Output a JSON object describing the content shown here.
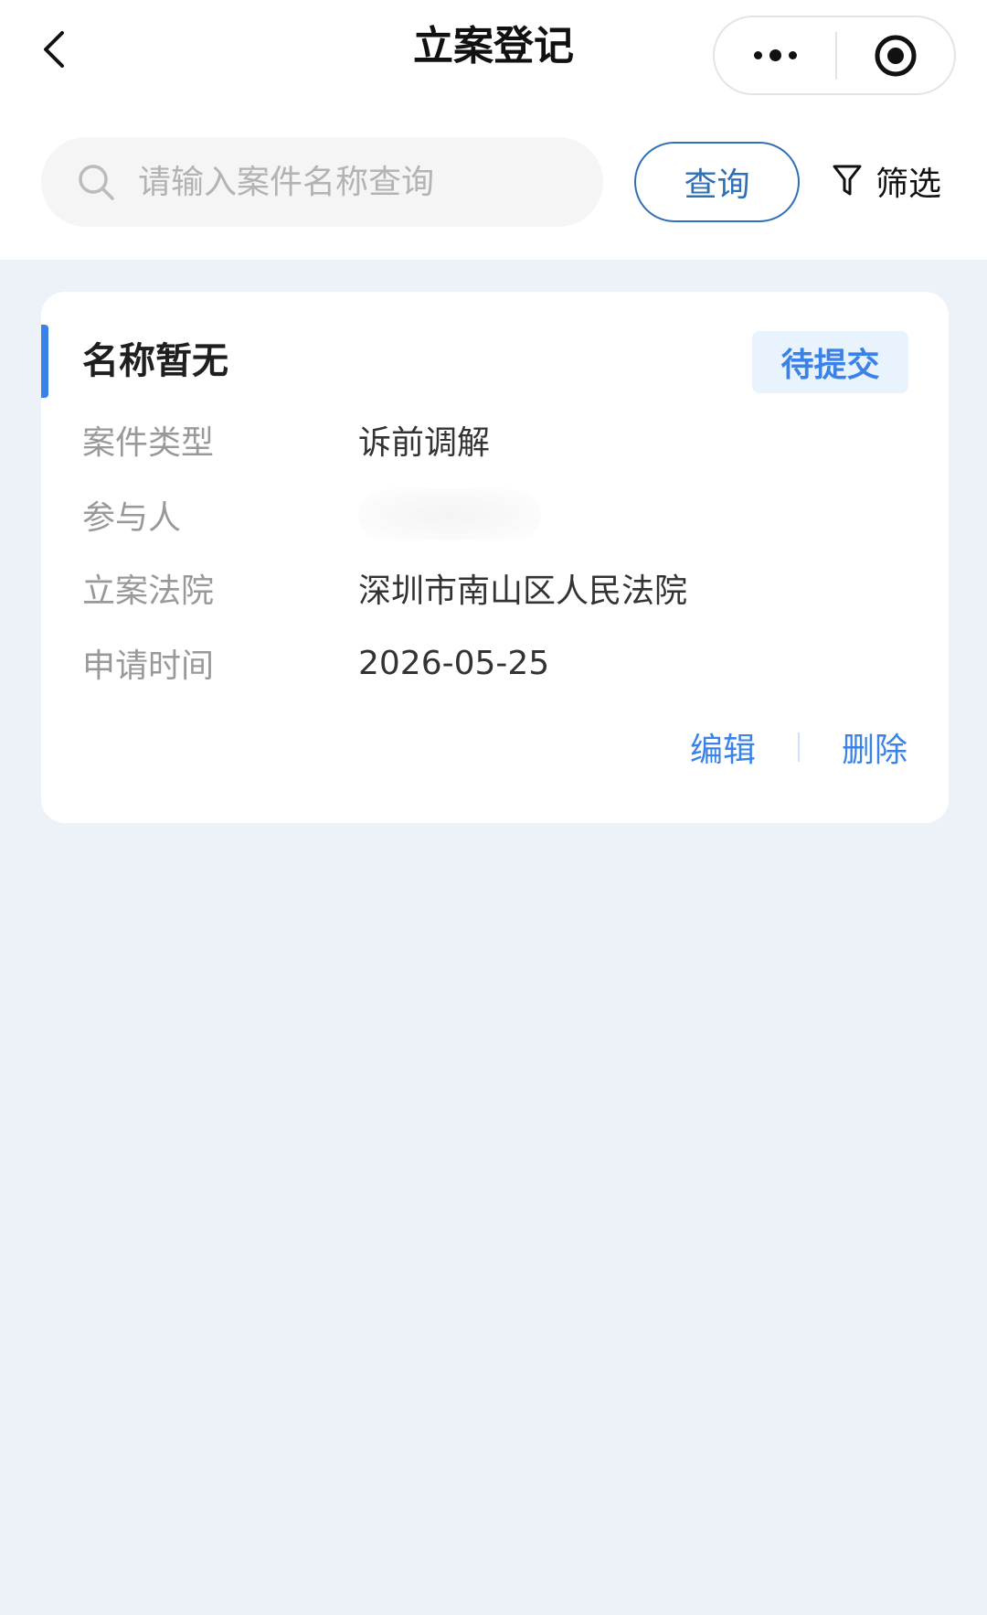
{
  "header": {
    "title": "立案登记"
  },
  "search": {
    "placeholder": "请输入案件名称查询",
    "value": "",
    "query_label": "查询",
    "filter_label": "筛选"
  },
  "cases": [
    {
      "name": "名称暂无",
      "status": "待提交",
      "fields": {
        "type_label": "案件类型",
        "type_value": "诉前调解",
        "participant_label": "参与人",
        "participant_value": "",
        "court_label": "立案法院",
        "court_value": "深圳市南山区人民法院",
        "time_label": "申请时间",
        "time_value": "2026-05-25"
      },
      "actions": {
        "edit": "编辑",
        "delete": "删除"
      }
    }
  ],
  "colors": {
    "accent": "#3a82e8",
    "query_border": "#2f6fb5",
    "page_bg": "#edf1f8",
    "badge_bg": "#e9f3fd"
  },
  "icons": {
    "back": "chevron-left-icon",
    "more": "more-dots-icon",
    "close": "target-circle-icon",
    "search": "search-icon",
    "filter": "funnel-icon"
  }
}
